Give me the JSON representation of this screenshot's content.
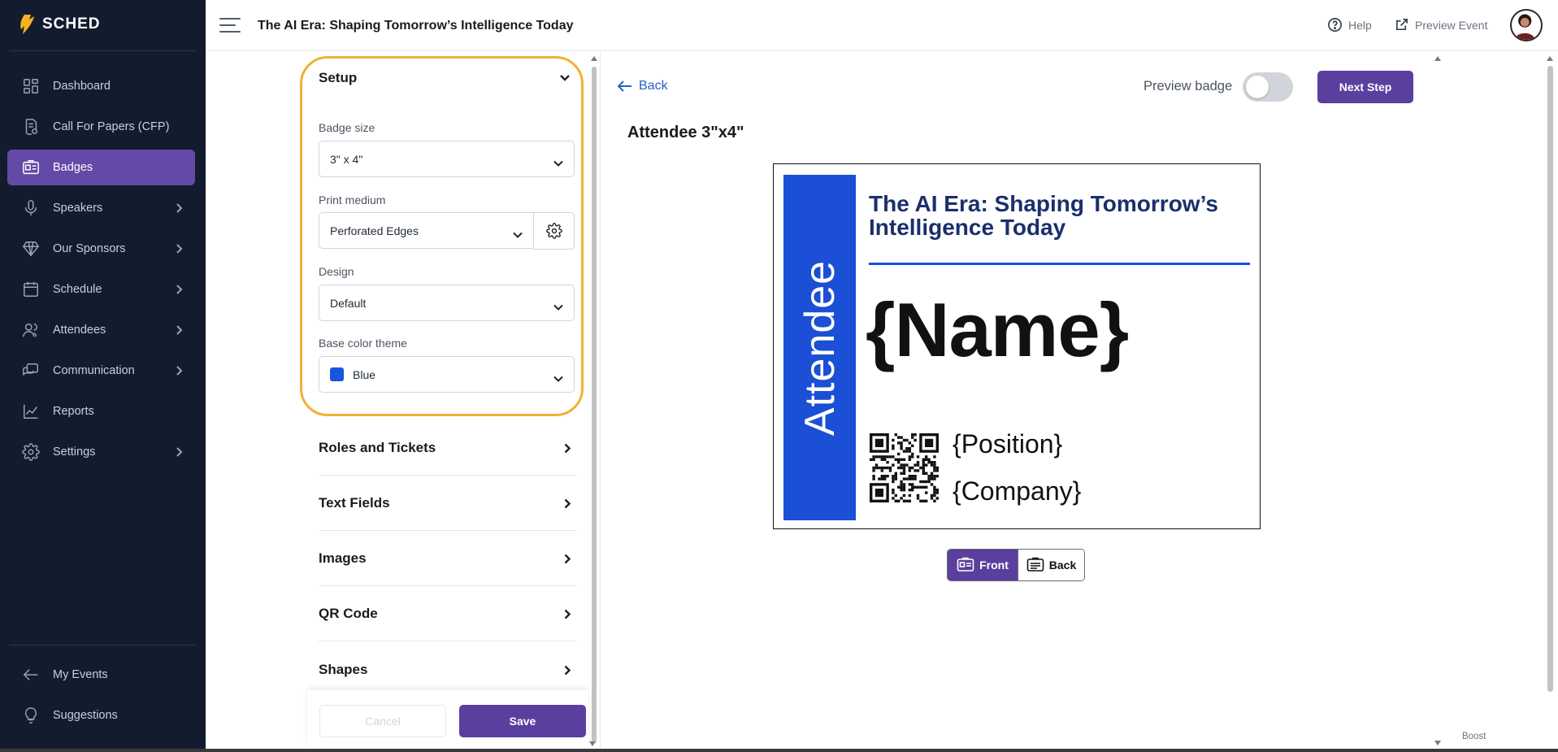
{
  "app": {
    "logo_text": "SCHED"
  },
  "sidebar": {
    "items": [
      {
        "label": "Dashboard",
        "icon": "dashboard-icon",
        "has_submenu": false,
        "active": false
      },
      {
        "label": "Call For Papers (CFP)",
        "icon": "document-icon",
        "has_submenu": false,
        "active": false
      },
      {
        "label": "Badges",
        "icon": "badge-icon",
        "has_submenu": false,
        "active": true
      },
      {
        "label": "Speakers",
        "icon": "microphone-icon",
        "has_submenu": true,
        "active": false
      },
      {
        "label": "Our Sponsors",
        "icon": "diamond-icon",
        "has_submenu": true,
        "active": false
      },
      {
        "label": "Schedule",
        "icon": "calendar-icon",
        "has_submenu": true,
        "active": false
      },
      {
        "label": "Attendees",
        "icon": "people-icon",
        "has_submenu": true,
        "active": false
      },
      {
        "label": "Communication",
        "icon": "chat-icon",
        "has_submenu": true,
        "active": false
      },
      {
        "label": "Reports",
        "icon": "chart-icon",
        "has_submenu": false,
        "active": false
      },
      {
        "label": "Settings",
        "icon": "gear-icon",
        "has_submenu": true,
        "active": false
      }
    ],
    "bottom": [
      {
        "label": "My Events",
        "icon": "arrow-left-icon"
      },
      {
        "label": "Suggestions",
        "icon": "lightbulb-icon"
      }
    ]
  },
  "header": {
    "event_title": "The AI Era: Shaping Tomorrow’s Intelligence Today",
    "help_label": "Help",
    "preview_label": "Preview Event"
  },
  "setup": {
    "title": "Setup",
    "badge_size_label": "Badge size",
    "badge_size_value": "3\" x 4\"",
    "print_medium_label": "Print medium",
    "print_medium_value": "Perforated Edges",
    "design_label": "Design",
    "design_value": "Default",
    "color_theme_label": "Base color theme",
    "color_theme_value": "Blue",
    "color_theme_hex": "#1a56db"
  },
  "sections": [
    {
      "label": "Roles and Tickets"
    },
    {
      "label": "Text Fields"
    },
    {
      "label": "Images"
    },
    {
      "label": "QR Code"
    },
    {
      "label": "Shapes"
    }
  ],
  "footer": {
    "cancel_label": "Cancel",
    "save_label": "Save"
  },
  "preview": {
    "back_label": "Back",
    "preview_badge_label": "Preview badge",
    "preview_badge_on": false,
    "next_label": "Next Step",
    "badge_title": "Attendee 3\"x4\"",
    "side_label": "Attendee",
    "badge_event": "The AI Era: Shaping Tomorrow’s Intelligence Today",
    "name_placeholder": "{Name}",
    "position_placeholder": "{Position}",
    "company_placeholder": "{Company}",
    "front_label": "Front",
    "back_toggle_label": "Back",
    "accent": "#1a4fd6"
  },
  "misc": {
    "boost_label": "Boost"
  },
  "colors": {
    "sidebar_bg": "#131c2e",
    "brand": "#5b3f9e",
    "highlight": "#f0b232"
  }
}
